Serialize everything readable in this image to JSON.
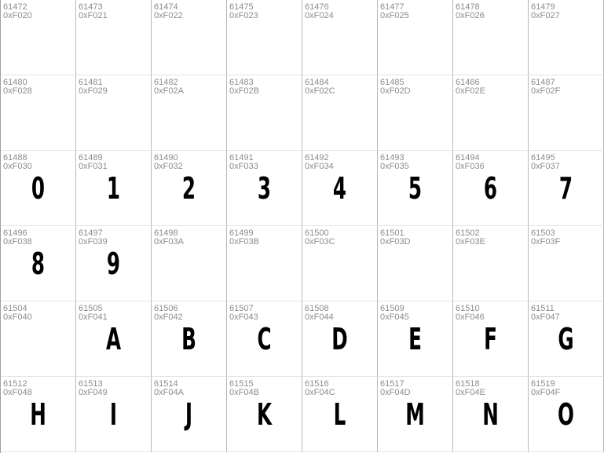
{
  "cells": [
    {
      "dec": "61472",
      "hex": "0xF020",
      "glyph": ""
    },
    {
      "dec": "61473",
      "hex": "0xF021",
      "glyph": ""
    },
    {
      "dec": "61474",
      "hex": "0xF022",
      "glyph": ""
    },
    {
      "dec": "61475",
      "hex": "0xF023",
      "glyph": ""
    },
    {
      "dec": "61476",
      "hex": "0xF024",
      "glyph": ""
    },
    {
      "dec": "61477",
      "hex": "0xF025",
      "glyph": ""
    },
    {
      "dec": "61478",
      "hex": "0xF026",
      "glyph": ""
    },
    {
      "dec": "61479",
      "hex": "0xF027",
      "glyph": ""
    },
    {
      "dec": "61480",
      "hex": "0xF028",
      "glyph": ""
    },
    {
      "dec": "61481",
      "hex": "0xF029",
      "glyph": ""
    },
    {
      "dec": "61482",
      "hex": "0xF02A",
      "glyph": ""
    },
    {
      "dec": "61483",
      "hex": "0xF02B",
      "glyph": ""
    },
    {
      "dec": "61484",
      "hex": "0xF02C",
      "glyph": ""
    },
    {
      "dec": "61485",
      "hex": "0xF02D",
      "glyph": ""
    },
    {
      "dec": "61486",
      "hex": "0xF02E",
      "glyph": ""
    },
    {
      "dec": "61487",
      "hex": "0xF02F",
      "glyph": ""
    },
    {
      "dec": "61488",
      "hex": "0xF030",
      "glyph": "0"
    },
    {
      "dec": "61489",
      "hex": "0xF031",
      "glyph": "1"
    },
    {
      "dec": "61490",
      "hex": "0xF032",
      "glyph": "2"
    },
    {
      "dec": "61491",
      "hex": "0xF033",
      "glyph": "3"
    },
    {
      "dec": "61492",
      "hex": "0xF034",
      "glyph": "4"
    },
    {
      "dec": "61493",
      "hex": "0xF035",
      "glyph": "5"
    },
    {
      "dec": "61494",
      "hex": "0xF036",
      "glyph": "6"
    },
    {
      "dec": "61495",
      "hex": "0xF037",
      "glyph": "7"
    },
    {
      "dec": "61496",
      "hex": "0xF038",
      "glyph": "8"
    },
    {
      "dec": "61497",
      "hex": "0xF039",
      "glyph": "9"
    },
    {
      "dec": "61498",
      "hex": "0xF03A",
      "glyph": ""
    },
    {
      "dec": "61499",
      "hex": "0xF03B",
      "glyph": ""
    },
    {
      "dec": "61500",
      "hex": "0xF03C",
      "glyph": ""
    },
    {
      "dec": "61501",
      "hex": "0xF03D",
      "glyph": ""
    },
    {
      "dec": "61502",
      "hex": "0xF03E",
      "glyph": ""
    },
    {
      "dec": "61503",
      "hex": "0xF03F",
      "glyph": ""
    },
    {
      "dec": "61504",
      "hex": "0xF040",
      "glyph": ""
    },
    {
      "dec": "61505",
      "hex": "0xF041",
      "glyph": "A"
    },
    {
      "dec": "61506",
      "hex": "0xF042",
      "glyph": "B"
    },
    {
      "dec": "61507",
      "hex": "0xF043",
      "glyph": "C"
    },
    {
      "dec": "61508",
      "hex": "0xF044",
      "glyph": "D"
    },
    {
      "dec": "61509",
      "hex": "0xF045",
      "glyph": "E"
    },
    {
      "dec": "61510",
      "hex": "0xF046",
      "glyph": "F"
    },
    {
      "dec": "61511",
      "hex": "0xF047",
      "glyph": "G"
    },
    {
      "dec": "61512",
      "hex": "0xF048",
      "glyph": "H"
    },
    {
      "dec": "61513",
      "hex": "0xF049",
      "glyph": "I"
    },
    {
      "dec": "61514",
      "hex": "0xF04A",
      "glyph": "J"
    },
    {
      "dec": "61515",
      "hex": "0xF04B",
      "glyph": "K"
    },
    {
      "dec": "61516",
      "hex": "0xF04C",
      "glyph": "L"
    },
    {
      "dec": "61517",
      "hex": "0xF04D",
      "glyph": "M"
    },
    {
      "dec": "61518",
      "hex": "0xF04E",
      "glyph": "N"
    },
    {
      "dec": "61519",
      "hex": "0xF04F",
      "glyph": "O"
    }
  ]
}
